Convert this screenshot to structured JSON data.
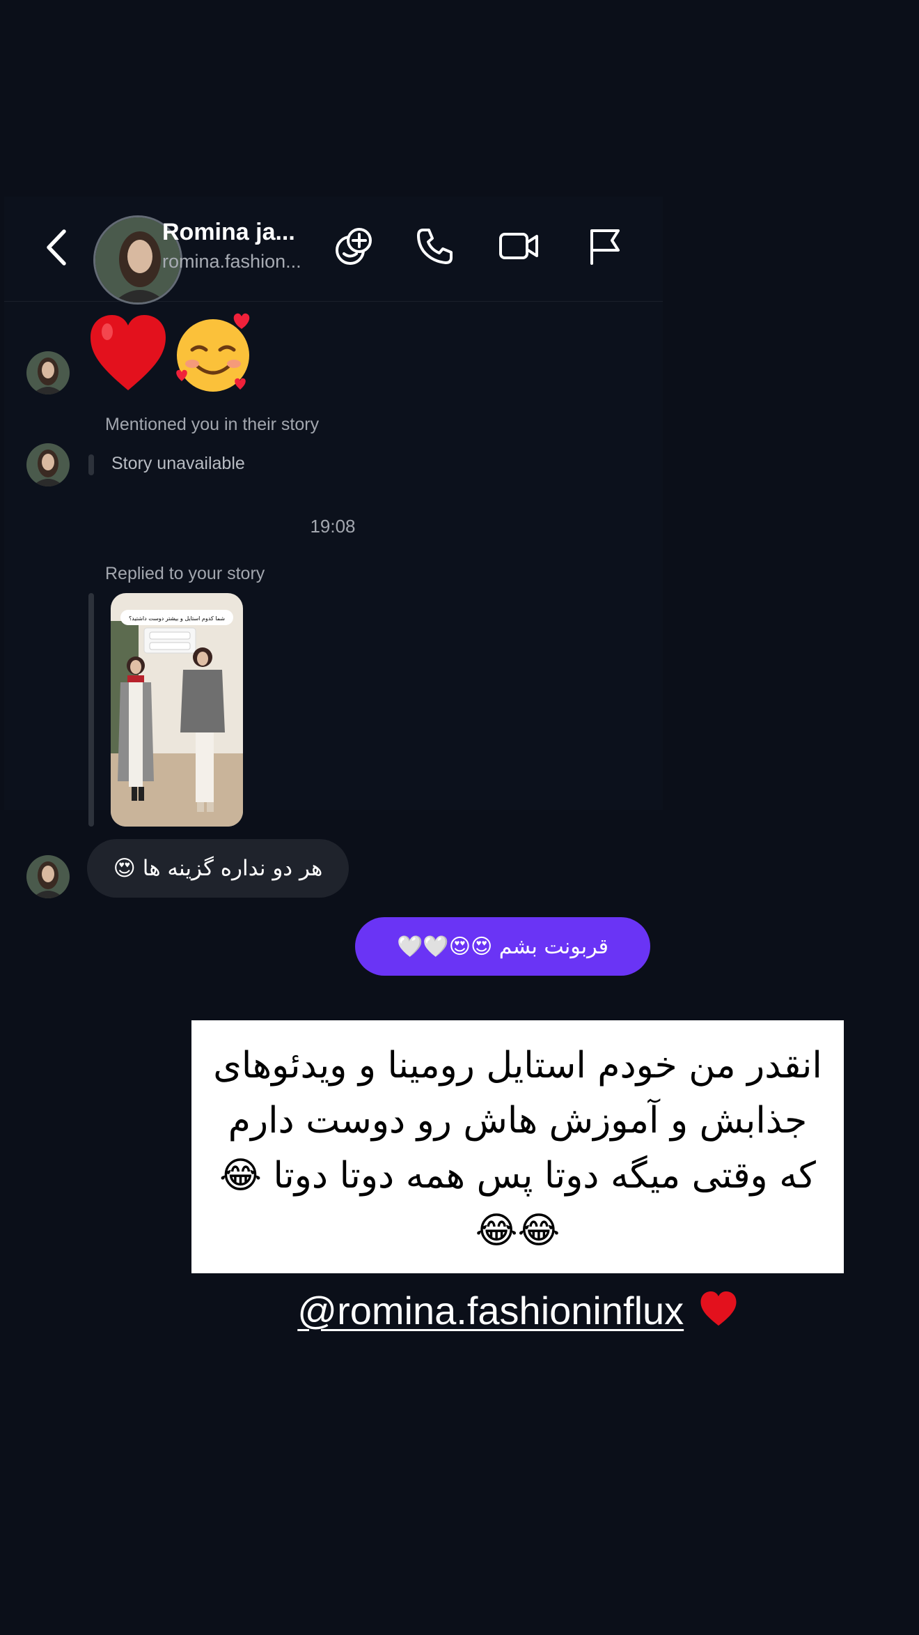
{
  "header": {
    "name": "Romina ja...",
    "username": "romina.fashion..."
  },
  "icons": {
    "back": "chevron-left-icon",
    "add_people": "add-people-icon",
    "call": "phone-icon",
    "video": "video-camera-icon",
    "report": "flag-icon"
  },
  "messages": {
    "reaction_emoji": "❤️🥰",
    "story_mention_label": "Mentioned you in their story",
    "story_unavailable": "Story unavailable",
    "timestamp": "19:08",
    "story_reply_label": "Replied to your story",
    "story_image_caption": "شما کدوم استایل و بیشتر دوست داشتید؟",
    "incoming_text": "هر دو نداره گزینه ها 😍",
    "outgoing_text": "قربونت بشم 😍😍🤍🤍"
  },
  "caption": {
    "text": "انقدر من خودم استایل رومینا و ویدئوهای جذابش و آموزش هاش رو دوست دارم که وقتی میگه دوتا پس همه دوتا دوتا 😂😂😂",
    "mention": "@romina.fashioninflux"
  },
  "colors": {
    "background": "#0b0f19",
    "outgoing_bubble": "#6a34f5",
    "incoming_bubble": "#1f232c",
    "muted_text": "#a3a7af"
  }
}
